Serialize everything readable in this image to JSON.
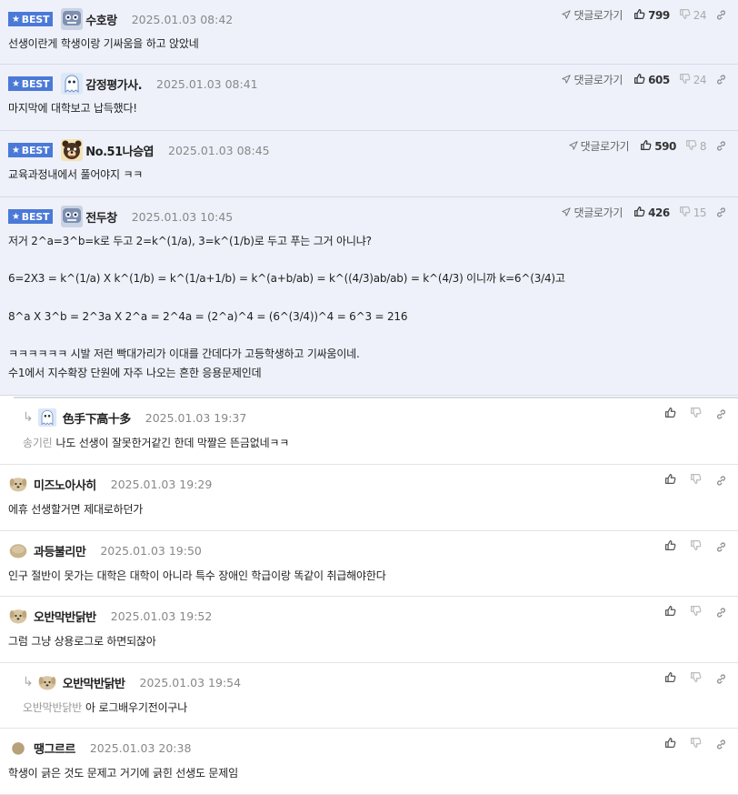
{
  "best_label": "BEST",
  "reply_label": "댓글로가기",
  "best": [
    {
      "nick": "수호랑",
      "date": "2025.01.03 08:42",
      "up": "799",
      "down": "24",
      "avatar": "robot",
      "text": "선생이란게 학생이랑 기싸움을 하고 앉았네"
    },
    {
      "nick": "감정평가사.",
      "date": "2025.01.03 08:41",
      "up": "605",
      "down": "24",
      "avatar": "ghost",
      "text": "마지막에 대학보고 납득했다!"
    },
    {
      "nick": "No.51나승엽",
      "date": "2025.01.03 08:45",
      "up": "590",
      "down": "8",
      "avatar": "bear",
      "text": "교육과정내에서 풀어야지 ㅋㅋ"
    },
    {
      "nick": "전두창",
      "date": "2025.01.03 10:45",
      "up": "426",
      "down": "15",
      "avatar": "robot",
      "lines": [
        "저거 2^a=3^b=k로 두고 2=k^(1/a), 3=k^(1/b)로 두고 푸는 그거 아니냐?",
        "",
        "6=2X3 = k^(1/a) X k^(1/b) = k^(1/a+1/b) = k^(a+b/ab) = k^((4/3)ab/ab) = k^(4/3) 이니까 k=6^(3/4)고",
        "",
        "8^a X 3^b = 2^3a X 2^a = 2^4a = (2^a)^4 = (6^(3/4))^4 = 6^3 = 216",
        "",
        "ㅋㅋㅋㅋㅋㅋ 시발 저런 빡대가리가 이대를 간데다가 고등학생하고 기싸움이네.",
        "수1에서 지수확장 단원에 자주 나오는 흔한 응용문제인데"
      ]
    }
  ],
  "comments": [
    {
      "nick": "色手下高十多",
      "date": "2025.01.03 19:37",
      "reply": true,
      "mention": "송기린",
      "text": "나도 선생이 잘못한거같긴 한데 막짤은 뜬금없네ㅋㅋ",
      "avatar": "ghost"
    },
    {
      "nick": "미즈노아사히",
      "date": "2025.01.03 19:29",
      "reply": false,
      "mention": "",
      "text": "에휴 선생할거면 제대로하던가",
      "avatar": "dog"
    },
    {
      "nick": "과등불리만",
      "date": "2025.01.03 19:50",
      "reply": false,
      "mention": "",
      "text": "인구 절반이 못가는 대학은 대학이 아니라 특수 장애인 학급이랑 똑같이 취급해야한다",
      "avatar": "blob"
    },
    {
      "nick": "오반막반닭반",
      "date": "2025.01.03 19:52",
      "reply": false,
      "mention": "",
      "text": "그럼 그냥 상용로그로 하면되잖아",
      "avatar": "dog"
    },
    {
      "nick": "오반막반닭반",
      "date": "2025.01.03 19:54",
      "reply": true,
      "mention": "오반막반닭반",
      "text": "아 로그배우기전이구나",
      "avatar": "dog"
    },
    {
      "nick": "땡그르르",
      "date": "2025.01.03 20:38",
      "reply": false,
      "mention": "",
      "text": "학생이 긁은 것도 문제고 거기에 긁힌 선생도 문제임",
      "avatar": "ball"
    }
  ],
  "colors": {
    "best_bg": "#eef1fa",
    "badge": "#4a79d8"
  }
}
